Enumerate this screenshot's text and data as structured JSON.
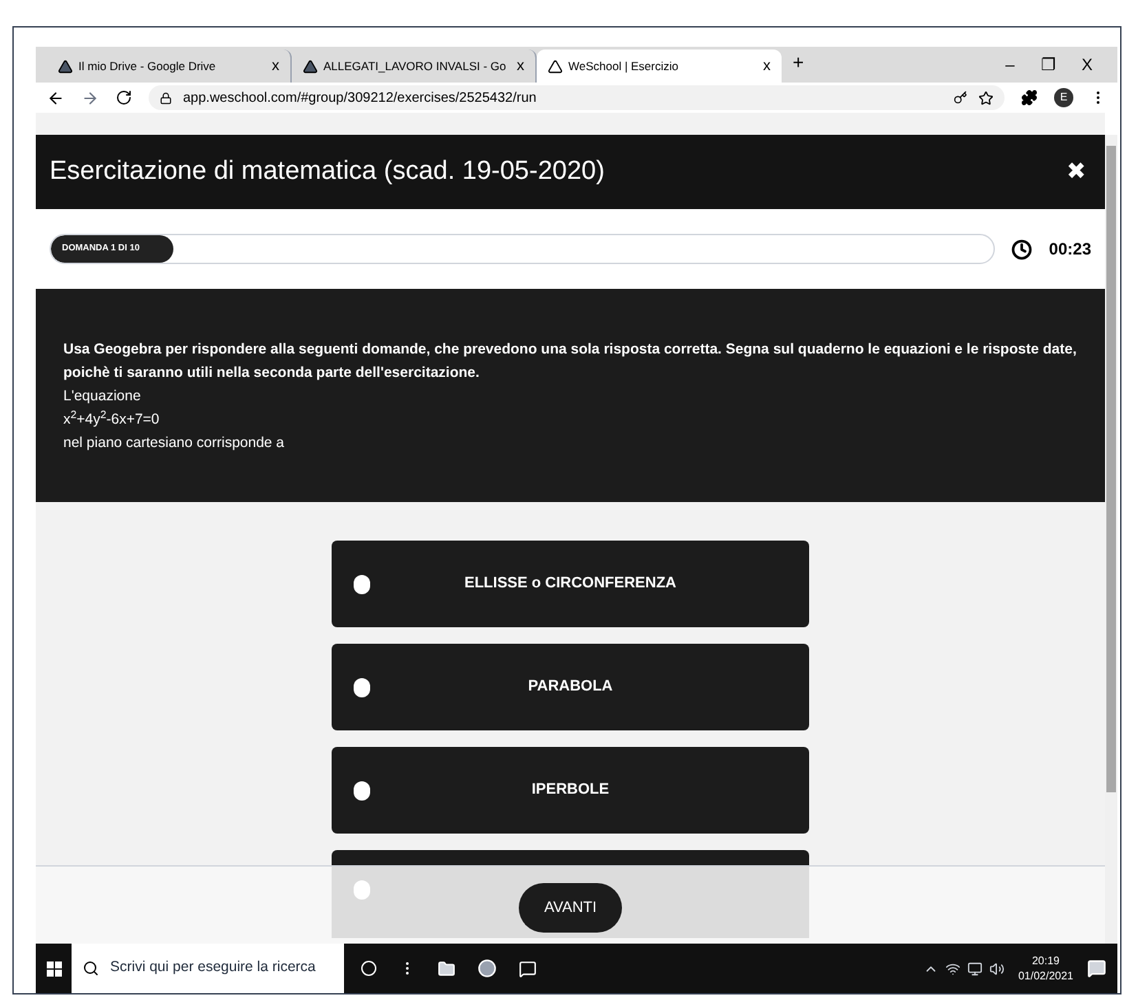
{
  "browser": {
    "tabs": [
      {
        "title": "Il mio Drive - Google Drive",
        "close": "x",
        "selected": false
      },
      {
        "title": "ALLEGATI_LAVORO INVALSI - Go",
        "close": "x",
        "selected": false
      },
      {
        "title": "WeSchool | Esercizio",
        "close": "x",
        "selected": true
      }
    ],
    "new_tab": "+",
    "window_controls": [
      "–",
      "❐",
      "X"
    ],
    "url": "app.weschool.com/#group/309212/exercises/2525432/run",
    "profile": "E"
  },
  "header": {
    "title": "Esercitazione di matematica (scad. 19-05-2020)",
    "close": "✖"
  },
  "progress": {
    "label": "DOMANDA 1 DI 10",
    "level": 0.13,
    "timer": "00:23"
  },
  "question": {
    "lines": [
      "Usa Geogebra per rispondere alla seguenti domande, che prevedono una sola risposta corretta. Segna sul quaderno le equazioni e le risposte date, poichè ti saranno utili nella seconda parte dell'esercitazione.",
      "L'equazione",
      "x$^{2}$+4y$^{2}$-6x+7=0",
      "nel piano cartesiano corrisponde a"
    ]
  },
  "options": [
    {
      "label": "ELLISSE o CIRCONFERENZA",
      "selected": false
    },
    {
      "label": "PARABOLA",
      "selected": false
    },
    {
      "label": "IPERBOLE",
      "selected": false
    },
    {
      "selected": false
    }
  ],
  "footer": {
    "button": "AVANTI"
  },
  "taskbar": {
    "search_placeholder": "Scrivi qui per eseguire la ricerca",
    "time": "20:19",
    "date": "01/02/2021"
  }
}
